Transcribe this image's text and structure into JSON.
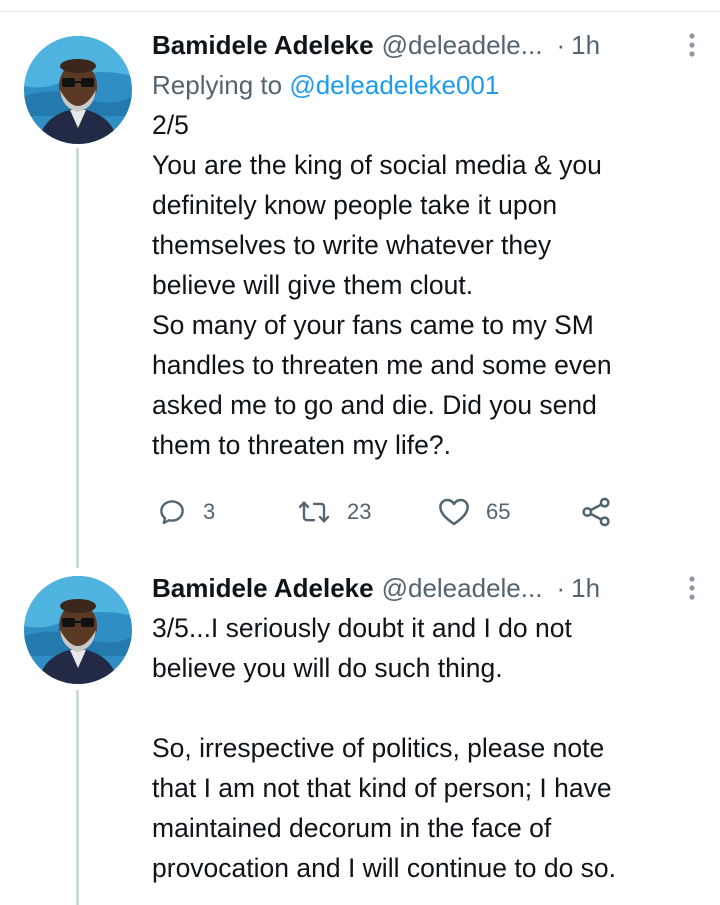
{
  "colors": {
    "text": "#0f1419",
    "secondary": "#536471",
    "link": "#1d9bf0",
    "thread_line": "#cfd9de"
  },
  "tweets": [
    {
      "author_name": "Bamidele Adeleke",
      "handle": "@deleadele...",
      "separator": "·",
      "time": "1h",
      "replying_prefix": "Replying to ",
      "replying_handle": "@deleadeleke001",
      "text": "2/5\nYou are the king of social media & you\ndefinitely know people take it upon\nthemselves to write whatever they\nbelieve will give them clout.\nSo many of your fans came to my SM\nhandles to threaten me and some even\nasked me to go and die. Did you send\nthem to threaten my life?.",
      "reply_count": "3",
      "retweet_count": "23",
      "like_count": "65",
      "icons": [
        "reply-icon",
        "retweet-icon",
        "like-icon",
        "share-icon",
        "more-icon"
      ]
    },
    {
      "author_name": "Bamidele Adeleke",
      "handle": "@deleadele...",
      "separator": "·",
      "time": "1h",
      "text": "3/5...I seriously doubt it and I do not\nbelieve you will do such thing.\n\nSo, irrespective of politics, please note\nthat I am not that kind of person; I have\nmaintained decorum in the face of\nprovocation and I will continue to do so.",
      "icons": [
        "more-icon"
      ]
    }
  ]
}
